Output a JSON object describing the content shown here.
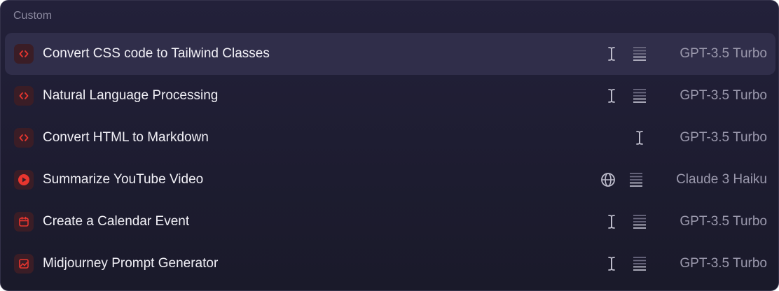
{
  "section": {
    "title": "Custom"
  },
  "colors": {
    "accent_red": "#e8362f",
    "icon_gray": "#bdbccb"
  },
  "commands": [
    {
      "label": "Convert CSS code to Tailwind Classes",
      "icon": "code-icon",
      "meta_icons": [
        "text-cursor-icon",
        "lines-icon"
      ],
      "model": "GPT-3.5 Turbo",
      "selected": true
    },
    {
      "label": "Natural Language Processing",
      "icon": "code-icon",
      "meta_icons": [
        "text-cursor-icon",
        "lines-icon"
      ],
      "model": "GPT-3.5 Turbo",
      "selected": false
    },
    {
      "label": "Convert HTML to Markdown",
      "icon": "code-icon",
      "meta_icons": [
        "text-cursor-icon"
      ],
      "model": "GPT-3.5 Turbo",
      "selected": false
    },
    {
      "label": "Summarize YouTube Video",
      "icon": "youtube-play-icon",
      "meta_icons": [
        "globe-icon",
        "lines-icon"
      ],
      "model": "Claude 3 Haiku",
      "selected": false
    },
    {
      "label": "Create a Calendar Event",
      "icon": "calendar-icon",
      "meta_icons": [
        "text-cursor-icon",
        "lines-icon"
      ],
      "model": "GPT-3.5 Turbo",
      "selected": false
    },
    {
      "label": "Midjourney Prompt Generator",
      "icon": "image-icon",
      "meta_icons": [
        "text-cursor-icon",
        "lines-icon"
      ],
      "model": "GPT-3.5 Turbo",
      "selected": false
    }
  ]
}
